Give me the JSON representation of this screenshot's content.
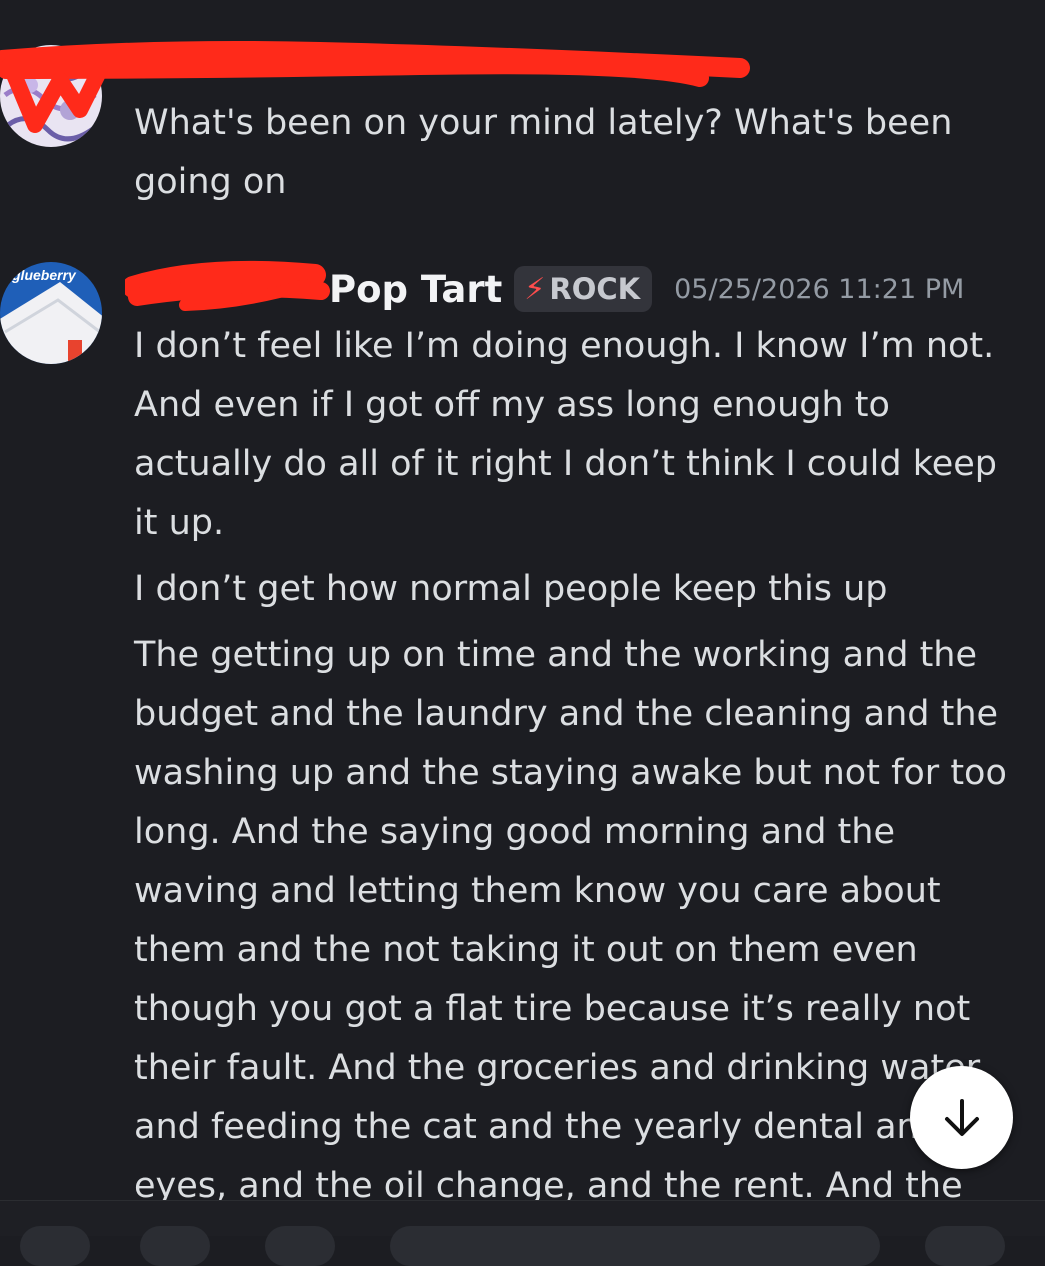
{
  "messages": [
    {
      "username": "",
      "timestamp": "",
      "paragraphs": [
        "What's been on your mind lately? What's been going on"
      ]
    },
    {
      "username": "Pop Tart",
      "badge": {
        "icon": "lightning-bolt-icon",
        "label": "ROCK"
      },
      "timestamp": "05/25/2026 11:21 PM",
      "avatar_text": "glueberry",
      "paragraphs": [
        "I don’t feel like I’m doing enough. I know I’m not. And even if I got off my ass long enough to actually do all of it right I don’t think I could keep it up.",
        "I don’t get how normal people keep this up",
        "The getting up on time and the working and the budget and the laundry and the cleaning and the washing up and the staying awake but not for too long. And the saying good morning and the waving and letting them know you care about them and the not taking it out on them even though you got a flat tire because it’s really not their fault. And the groceries and drinking water and feeding the cat and the yearly dental and eyes, and the oil change, and the rent. And the"
      ]
    }
  ],
  "jump_button": {
    "icon": "arrow-down-icon"
  },
  "colors": {
    "background": "#1c1d22",
    "text": "#dbdee1",
    "username": "#f2f3f5",
    "timestamp": "#949ba4",
    "redaction": "#ff2a1a"
  }
}
